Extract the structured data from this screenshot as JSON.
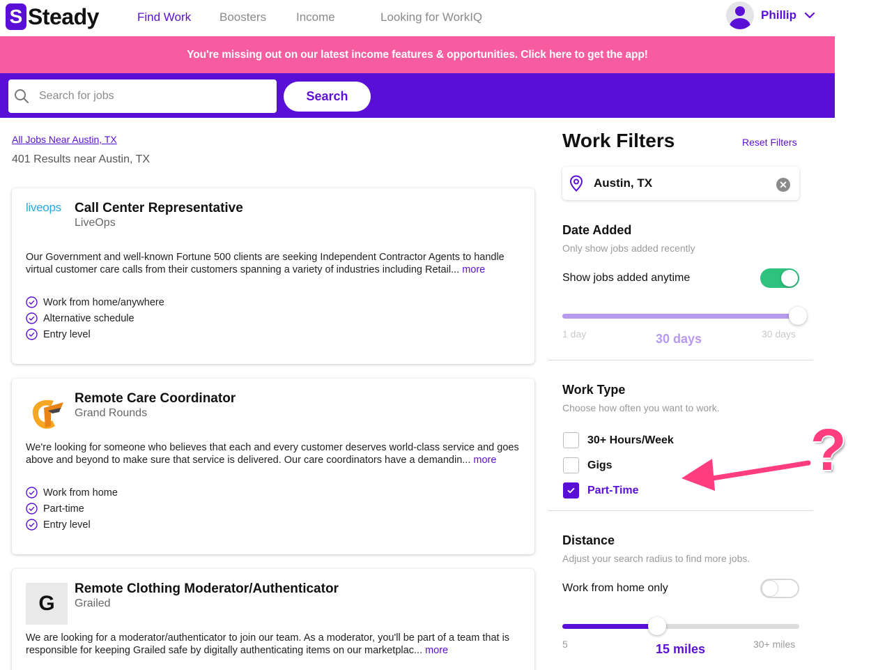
{
  "nav": {
    "logo_mark": "S",
    "logo_text": "Steady",
    "links": [
      "Find Work",
      "Boosters",
      "Income",
      "Looking for WorkIQ"
    ],
    "user_name": "Phillip"
  },
  "banner": {
    "text": "You're missing out on our latest income features & opportunities. Click here to get the app!"
  },
  "search": {
    "placeholder": "Search for jobs",
    "button_label": "Search"
  },
  "results": {
    "breadcrumb": "All Jobs Near Austin, TX",
    "summary": "401 Results near Austin, TX"
  },
  "jobs": [
    {
      "title": "Call Center Representative",
      "company": "LiveOps",
      "logo_text": "liveops",
      "description": "Our Government and well-known Fortune 500 clients are seeking Independent Contractor Agents to handle virtual customer care calls from their customers spanning a variety of industries including Retail...",
      "more": "more",
      "tags": [
        "Work from home/anywhere",
        "Alternative schedule",
        "Entry level"
      ]
    },
    {
      "title": "Remote Care Coordinator",
      "company": "Grand Rounds",
      "logo_text": "",
      "description": "We're looking for someone who believes that each and every customer deserves world-class service and goes above and beyond to make sure that service is delivered. Our care coordinators have a demandin...",
      "more": "more",
      "tags": [
        "Work from home",
        "Part-time",
        "Entry level"
      ]
    },
    {
      "title": "Remote Clothing Moderator/Authenticator",
      "company": "Grailed",
      "logo_text": "G",
      "description": "We are looking for a moderator/authenticator to join our team. As a moderator, you'll be part of a team that is responsible for keeping Grailed safe by digitally authenticating items on our marketplac...",
      "more": "more",
      "tags": []
    }
  ],
  "filters": {
    "title": "Work Filters",
    "reset_label": "Reset Filters",
    "location": "Austin, TX",
    "clear_glyph": "✕",
    "date_added": {
      "title": "Date Added",
      "subtitle": "Only show jobs added recently",
      "toggle_label": "Show jobs added anytime",
      "toggle_on": true,
      "slider_min": "1 day",
      "slider_max": "30 days",
      "slider_value": "30 days",
      "slider_fraction": 1.0
    },
    "work_type": {
      "title": "Work Type",
      "subtitle": "Choose how often you want to work.",
      "options": [
        {
          "label": "30+ Hours/Week",
          "checked": false
        },
        {
          "label": "Gigs",
          "checked": false
        },
        {
          "label": "Part-Time",
          "checked": true
        }
      ]
    },
    "distance": {
      "title": "Distance",
      "subtitle": "Adjust your search radius to find more jobs.",
      "toggle_label": "Work from home only",
      "toggle_on": false,
      "slider_min": "5",
      "slider_max": "30+ miles",
      "slider_value": "15 miles",
      "slider_fraction": 0.4
    }
  },
  "annotation": {
    "glyph": "?"
  },
  "colors": {
    "brand": "#5a0fd6",
    "banner": "#f75ca1",
    "toggle_on": "#2ec27e",
    "annotation": "#ff3d7f",
    "date_slider_fill": "#b79af0"
  }
}
